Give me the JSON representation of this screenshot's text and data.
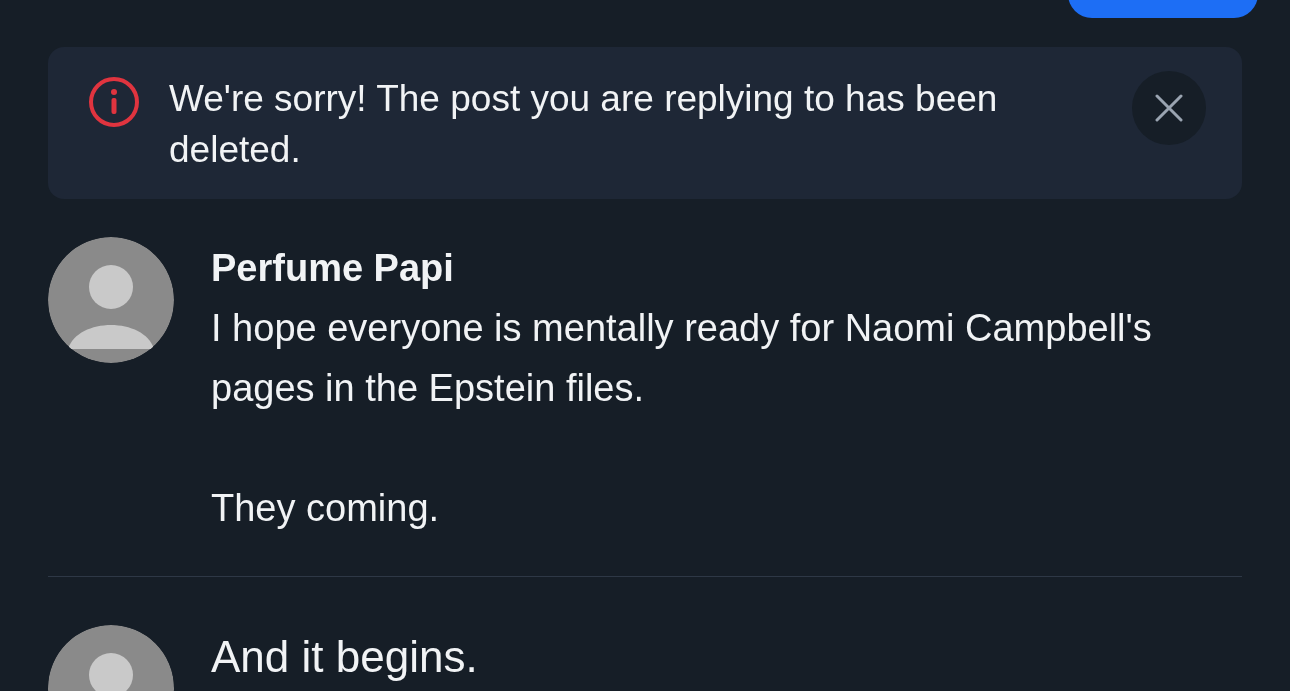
{
  "alert": {
    "message": "We're sorry! The post you are replying to has been deleted."
  },
  "posts": [
    {
      "author": "Perfume Papi",
      "paragraphs": [
        "I hope everyone is mentally ready for Naomi Campbell's pages in the Epstein files.",
        "They coming."
      ]
    }
  ],
  "composer": {
    "value": "And it begins."
  }
}
